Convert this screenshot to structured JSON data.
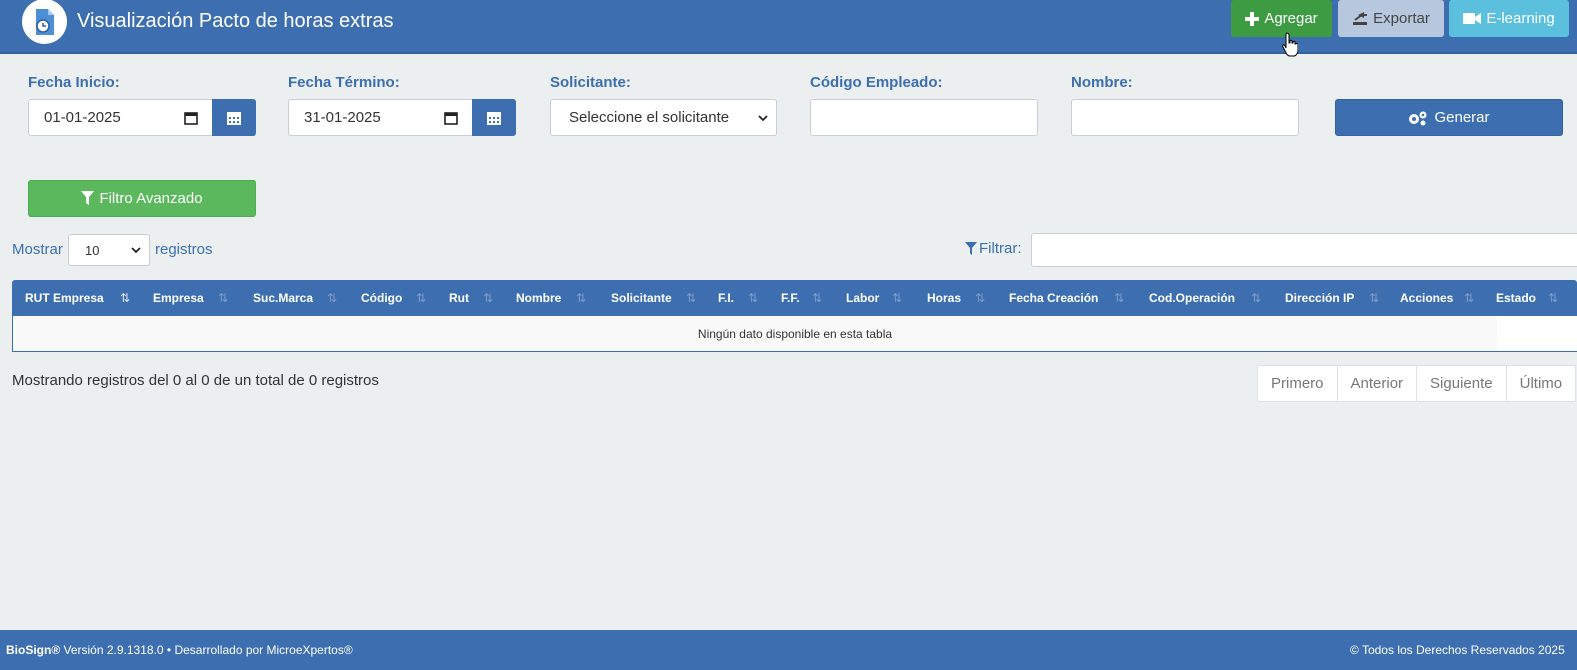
{
  "header": {
    "title": "Visualización Pacto de horas extras",
    "logo_icon": "document-clock-icon",
    "buttons": {
      "add": "Agregar",
      "export": "Exportar",
      "elearning": "E-learning"
    }
  },
  "filters": {
    "fecha_inicio": {
      "label": "Fecha Inicio:",
      "value": "01-01-2025"
    },
    "fecha_termino": {
      "label": "Fecha Término:",
      "value": "31-01-2025"
    },
    "solicitante": {
      "label": "Solicitante:",
      "selected": "Seleccione el solicitante"
    },
    "codigo_empleado": {
      "label": "Código Empleado:",
      "value": ""
    },
    "nombre": {
      "label": "Nombre:",
      "value": ""
    },
    "generar_label": "Generar",
    "filtro_avanzado_label": "Filtro Avanzado"
  },
  "table_controls": {
    "show_prefix": "Mostrar",
    "page_size": "10",
    "show_suffix": "registros",
    "filter_label": "Filtrar:",
    "filter_value": ""
  },
  "table": {
    "columns": [
      "RUT Empresa",
      "Empresa",
      "Suc.Marca",
      "Código",
      "Rut",
      "Nombre",
      "Solicitante",
      "F.I.",
      "F.F.",
      "Labor",
      "Horas",
      "Fecha Creación",
      "Cod.Operación",
      "Dirección IP",
      "Acciones",
      "Estado"
    ],
    "empty_message": "Ningún dato disponible en esta tabla"
  },
  "pagination": {
    "info": "Mostrando registros del 0 al 0 de un total de 0 registros",
    "first": "Primero",
    "prev": "Anterior",
    "next": "Siguiente",
    "last": "Último"
  },
  "footer": {
    "brand": "BioSign®",
    "version_text": " Versión 2.9.1318.0 • Desarrollado por MicroeXpertos®",
    "copyright": "© Todos los Derechos Reservados 2025"
  },
  "colors": {
    "primary": "#3d6fb0",
    "success": "#3d9b42",
    "info": "#5bc0de",
    "background": "#ebeff0"
  }
}
